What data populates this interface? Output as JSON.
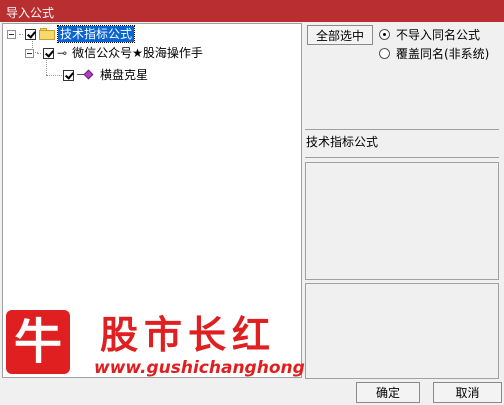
{
  "window": {
    "title": "导入公式"
  },
  "tree": {
    "root": {
      "label": "技术指标公式",
      "checked": true
    },
    "child": {
      "label": "微信公众号★股海操作手",
      "checked": true
    },
    "leaf": {
      "label": "横盘克星",
      "checked": true
    }
  },
  "options": {
    "select_all_label": "全部选中",
    "radio_skip_label": "不导入同名公式",
    "radio_overwrite_label": "覆盖同名(非系统)",
    "selected": "skip"
  },
  "info": {
    "category_label": "技术指标公式"
  },
  "watermark": {
    "logo_char": "牛",
    "name": "股市长红",
    "url": "www.gushichanghong.com"
  },
  "footer": {
    "ok_label": "确定",
    "cancel_label": "取消"
  }
}
